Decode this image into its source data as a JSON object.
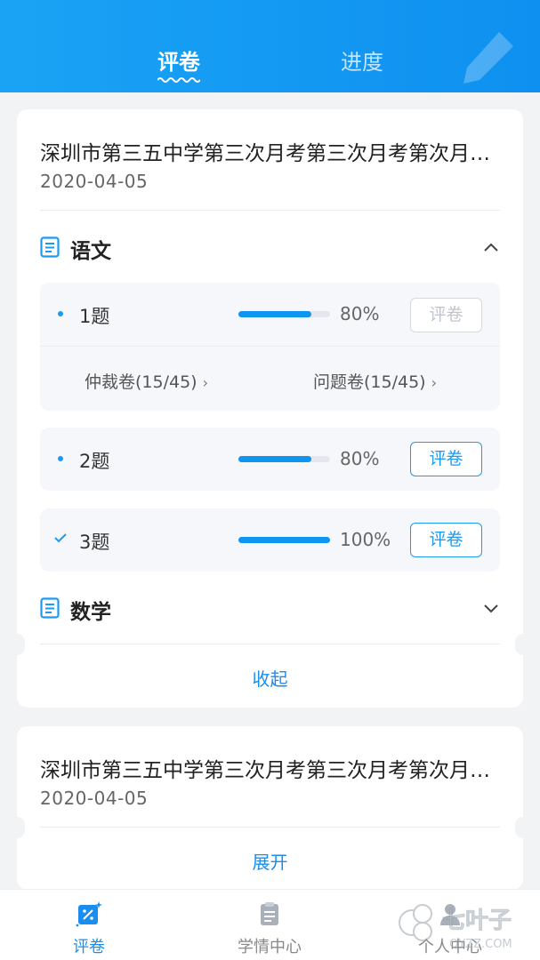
{
  "header": {
    "tabs": [
      {
        "label": "评卷",
        "active": true
      },
      {
        "label": "进度",
        "active": false
      }
    ],
    "background_color": "#1a9bf0"
  },
  "exams": [
    {
      "title": "深圳市第三五中学第三次月考第三次月考第次月考第三次月考",
      "date": "2020-04-05",
      "subjects": [
        {
          "name": "语文",
          "expanded": true,
          "questions": [
            {
              "label": "1题",
              "progress_percent": 80,
              "percent_text": "80%",
              "button": "评卷",
              "button_enabled": false,
              "checked": false,
              "sub_links": [
                {
                  "label": "仲裁卷(15/45)"
                },
                {
                  "label": "问题卷(15/45)"
                }
              ]
            },
            {
              "label": "2题",
              "progress_percent": 80,
              "percent_text": "80%",
              "button": "评卷",
              "button_enabled": true,
              "checked": false
            },
            {
              "label": "3题",
              "progress_percent": 100,
              "percent_text": "100%",
              "button": "评卷",
              "button_enabled": true,
              "checked": true
            }
          ]
        },
        {
          "name": "数学",
          "expanded": false
        }
      ],
      "toggle_label": "收起"
    },
    {
      "title": "深圳市第三五中学第三次月考第三次月考第次月考第三次月考",
      "date": "2020-04-05",
      "toggle_label": "展开"
    }
  ],
  "bottom_nav": [
    {
      "label": "评卷",
      "icon": "grading-icon",
      "active": true
    },
    {
      "label": "学情中心",
      "icon": "clipboard-icon",
      "active": false
    },
    {
      "label": "个人中心",
      "icon": "person-icon",
      "active": false
    }
  ],
  "watermark": {
    "text": "七叶子",
    "subtext": "QYZZ.COM"
  },
  "accent_color": "#1a8ef0"
}
